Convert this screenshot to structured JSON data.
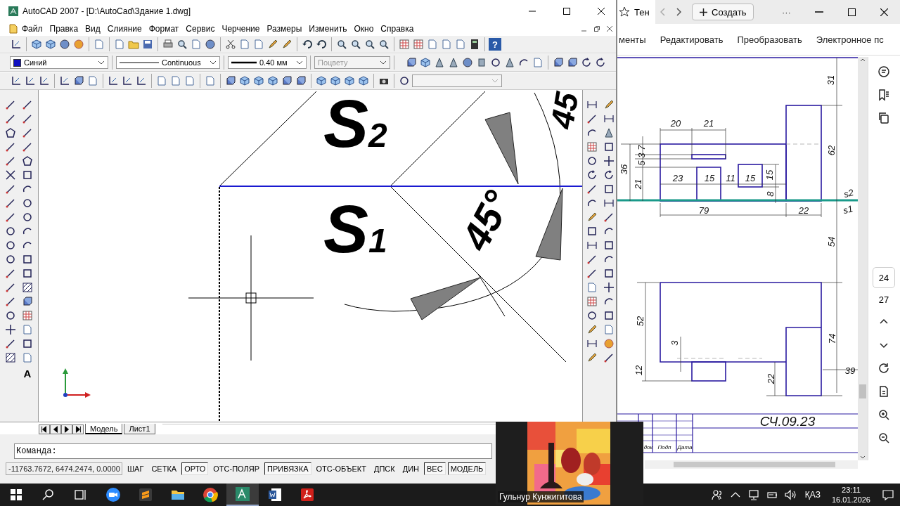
{
  "autocad": {
    "title": "AutoCAD 2007 - [D:\\AutoCad\\Здание 1.dwg]",
    "menu": [
      "Файл",
      "Правка",
      "Вид",
      "Слияние",
      "Формат",
      "Сервис",
      "Черчение",
      "Размеры",
      "Изменить",
      "Окно",
      "Справка"
    ],
    "help_button": "?",
    "layer_dropdown": {
      "value": "Синий",
      "color": "#1010c0"
    },
    "linetype_dropdown": {
      "value": "Continuous"
    },
    "lineweight_dropdown": {
      "value": "0.40 мм"
    },
    "plotstyle_dropdown": {
      "value": "Поцвету",
      "disabled": true
    },
    "text_tool": "A",
    "drawing_labels": [
      "S$_{2}$",
      "S$_{1}$",
      "45°",
      "45"
    ],
    "layout_tabs": [
      {
        "label": "Модель",
        "selected": true
      },
      {
        "label": "Лист1",
        "selected": false
      }
    ],
    "command_prompt": "Команда:",
    "coordinates": "-11763.7672, 6474.2474, 0.0000",
    "status_toggles": [
      {
        "label": "ШАГ",
        "on": false
      },
      {
        "label": "СЕТКА",
        "on": false
      },
      {
        "label": "ОРТО",
        "on": true
      },
      {
        "label": "ОТС-ПОЛЯР",
        "on": false
      },
      {
        "label": "ПРИВЯЗКА",
        "on": true
      },
      {
        "label": "ОТС-ОБЪЕКТ",
        "on": false
      },
      {
        "label": "ДПСК",
        "on": false
      },
      {
        "label": "ДИН",
        "on": false
      },
      {
        "label": "ВЕС",
        "on": true
      },
      {
        "label": "МОДЕЛЬ",
        "on": true
      }
    ]
  },
  "pdf_viewer": {
    "tab_title": "Тен",
    "new_button": "Создать",
    "more_button": "···",
    "toolbar": [
      "менты",
      "Редактировать",
      "Преобразовать",
      "Электронное пс"
    ],
    "drawing_dimensions": [
      "31",
      "20",
      "21",
      "5",
      "3",
      "7",
      "36",
      "21",
      "23",
      "15",
      "11",
      "15",
      "15",
      "62",
      "8",
      "79",
      "22",
      "s2",
      "s1",
      "54",
      "52",
      "3",
      "74",
      "12",
      "22",
      "39"
    ],
    "title_block": {
      "code": "СЧ.09.23",
      "headers": [
        "док",
        "Подп",
        "Дата"
      ]
    },
    "page_number": "24",
    "page_count": "27"
  },
  "video_tile": {
    "name": "Гульнур Кунжигитова"
  },
  "taskbar": {
    "language": "ҚАЗ",
    "time": "23:11",
    "date": "16.01.2026"
  }
}
